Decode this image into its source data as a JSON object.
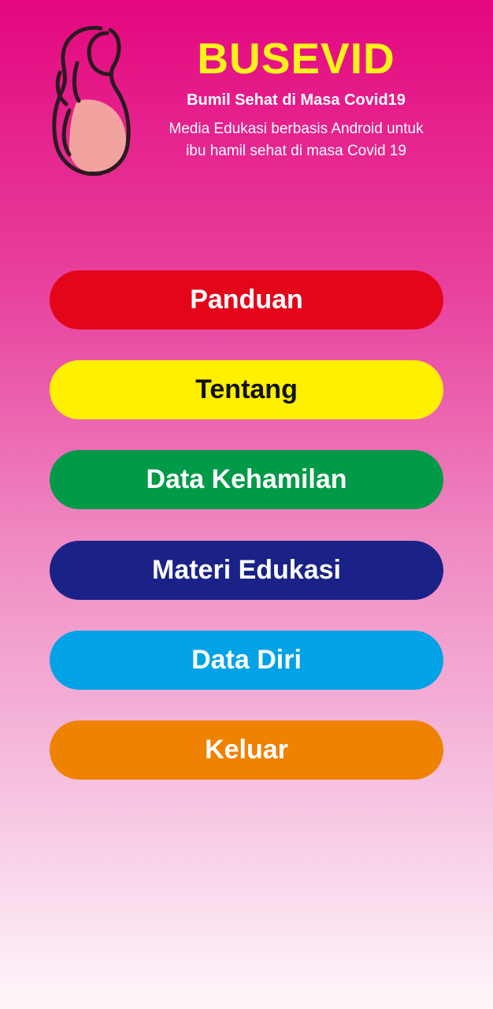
{
  "header": {
    "title": "BUSEVID",
    "subtitle": "Bumil Sehat di Masa Covid19",
    "description_line1": "Media Edukasi berbasis Android untuk",
    "description_line2": "ibu hamil sehat di masa Covid 19",
    "logo_icon": "pregnant-woman-icon"
  },
  "colors": {
    "title": "#fff21a",
    "background_top": "#e4077f",
    "background_bottom": "#fef7fb"
  },
  "menu": [
    {
      "label": "Panduan",
      "bg": "#e3061a",
      "fg": "#ffffff"
    },
    {
      "label": "Tentang",
      "bg": "#fff000",
      "fg": "#111111"
    },
    {
      "label": "Data Kehamilan",
      "bg": "#009a48",
      "fg": "#ffffff"
    },
    {
      "label": "Materi Edukasi",
      "bg": "#1b2287",
      "fg": "#ffffff"
    },
    {
      "label": "Data Diri",
      "bg": "#01a2e6",
      "fg": "#ffffff"
    },
    {
      "label": "Keluar",
      "bg": "#ef8200",
      "fg": "#ffffff"
    }
  ]
}
